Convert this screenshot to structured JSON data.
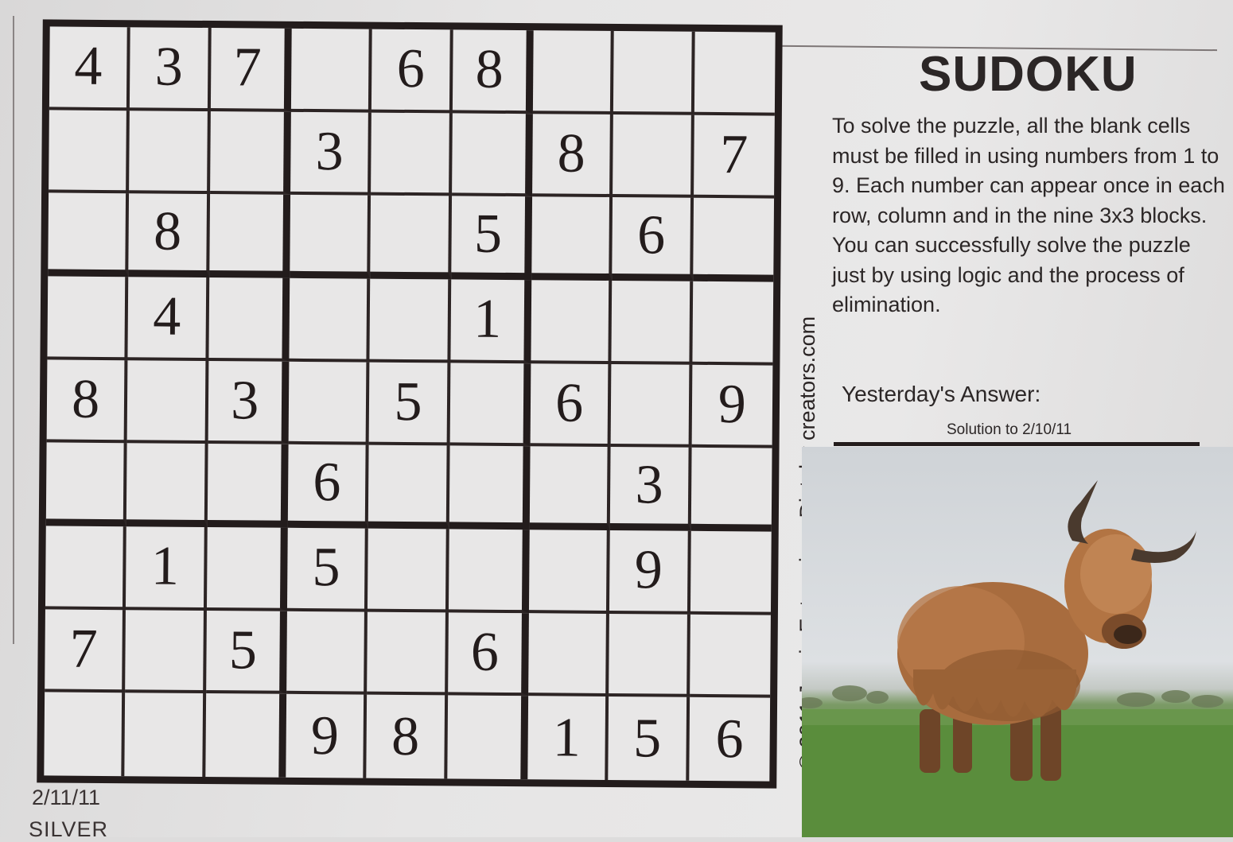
{
  "puzzle": {
    "title": "SUDOKU",
    "rules": "To solve the puzzle, all the blank cells must be filled in using numbers from 1 to 9. Each number can appear once in each row, column and in the nine 3x3 blocks. You can successfully solve the puzzle just by using logic and the process of elimination.",
    "yesterday_label": "Yesterday's Answer:",
    "solution_label": "Solution to 2/10/11",
    "date": "2/11/11",
    "difficulty": "SILVER",
    "credit": "© 2011 Janric Enterprises Dist. by creators.com",
    "grid": [
      [
        "4",
        "3",
        "7",
        "",
        "6",
        "8",
        "",
        "",
        ""
      ],
      [
        "",
        "",
        "",
        "3",
        "",
        "",
        "8",
        "",
        "7"
      ],
      [
        "",
        "8",
        "",
        "",
        "",
        "5",
        "",
        "6",
        ""
      ],
      [
        "",
        "4",
        "",
        "",
        "",
        "1",
        "",
        "",
        ""
      ],
      [
        "8",
        "",
        "3",
        "",
        "5",
        "",
        "6",
        "",
        "9"
      ],
      [
        "",
        "",
        "",
        "6",
        "",
        "",
        "",
        "3",
        ""
      ],
      [
        "",
        "1",
        "",
        "5",
        "",
        "",
        "",
        "9",
        ""
      ],
      [
        "7",
        "",
        "5",
        "",
        "",
        "6",
        "",
        "",
        ""
      ],
      [
        "",
        "",
        "",
        "9",
        "8",
        "",
        "1",
        "5",
        "6"
      ]
    ]
  },
  "photo": {
    "subject": "highland-cow",
    "colors": {
      "sky": "#d6dadd",
      "grass": "#5d8d3e",
      "fur": "#a66a3c"
    }
  }
}
